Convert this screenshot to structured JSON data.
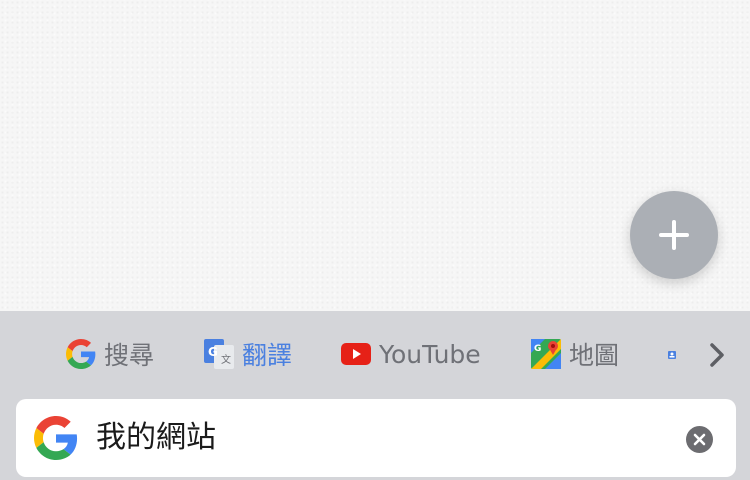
{
  "shortcuts": [
    {
      "label": "搜尋",
      "icon": "google-g-icon",
      "active": false
    },
    {
      "label": "翻譯",
      "icon": "google-translate-icon",
      "active": true
    },
    {
      "label": "YouTube",
      "icon": "youtube-icon",
      "active": false
    },
    {
      "label": "地圖",
      "icon": "google-maps-icon",
      "active": false
    }
  ],
  "next_icon": "chevron-right-icon",
  "fab_icon": "plus-icon",
  "search": {
    "value": "我的網站",
    "logo": "google-g-icon",
    "clear_icon": "clear-x-icon"
  },
  "colors": {
    "active_shortcut": "#4a80e0",
    "inactive_shortcut": "#6f7177",
    "fab": "#abafb5",
    "keyboard_bg": "#d4d5d9"
  }
}
